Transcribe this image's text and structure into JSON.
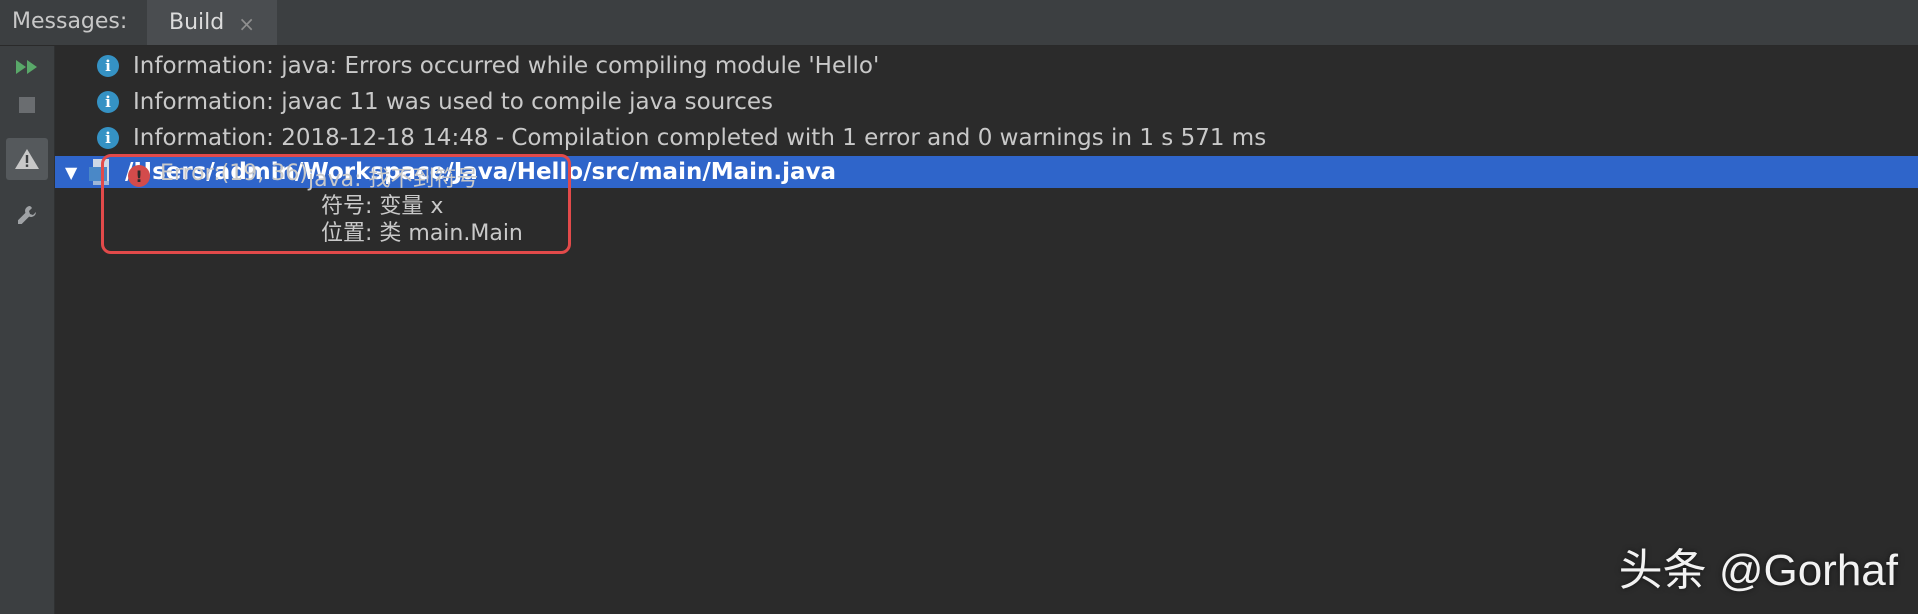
{
  "tabbar": {
    "messages_label": "Messages:",
    "build_tab_label": "Build",
    "close_glyph": "×"
  },
  "messages": [
    {
      "type": "info",
      "icon": "info-icon",
      "text": "Information: java: Errors occurred while compiling module 'Hello'"
    },
    {
      "type": "info",
      "icon": "info-icon",
      "text": "Information: javac 11 was used to compile java sources"
    },
    {
      "type": "info",
      "icon": "info-icon",
      "text": "Information: 2018-12-18 14:48 - Compilation completed with 1 error and 0 warnings in 1 s 571 ms"
    }
  ],
  "file_node": {
    "path": "/Users/admin/Workspace/Java/Hello/src/main/Main.java",
    "expanded": true
  },
  "error": {
    "icon": "error-icon",
    "location": "Error:(19, 36)",
    "message": "java: 找不到符号",
    "symbol_line": "符号:   变量 x",
    "position_line": "位置: 类 main.Main"
  },
  "colors": {
    "selected_row": "#2f65ca",
    "info_icon": "#3592c4",
    "error_icon": "#d34b4b",
    "highlight_border": "#e24a4a",
    "run_icon": "#59a869"
  },
  "watermark": "头条 @Gorhaf"
}
